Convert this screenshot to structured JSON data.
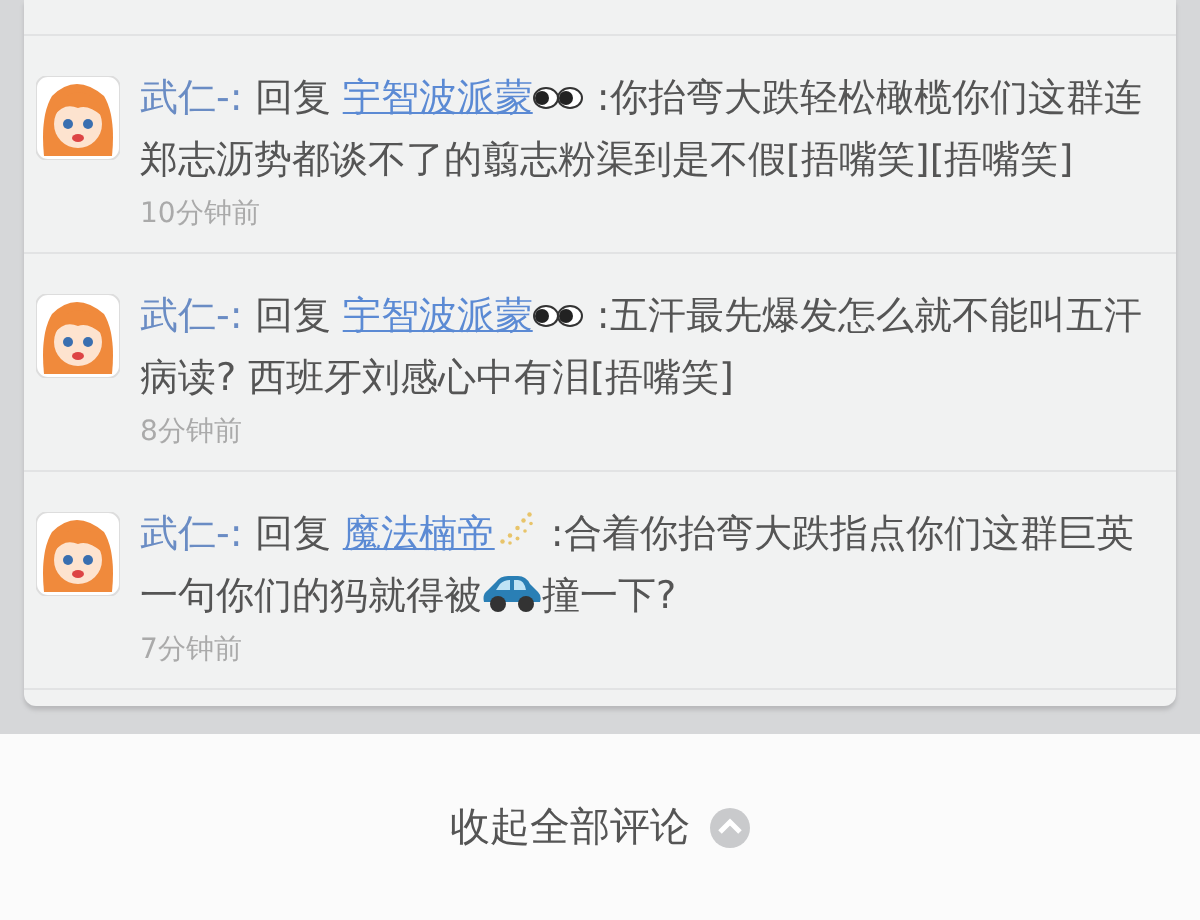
{
  "comments": [
    {
      "author": "武仁-:",
      "reply_word": "回复",
      "mention": "宇智波派蒙",
      "mention_emoji": {
        "kind": "eyes"
      },
      "segments": [
        {
          "kind": "text",
          "text": ":你抬弯大跌轻松橄榄你们这群连郑志沥势都谈不了的翦志粉渠到是不假[捂嘴笑][捂嘴笑]"
        }
      ],
      "time": "10分钟前"
    },
    {
      "author": "武仁-:",
      "reply_word": "回复",
      "mention": "宇智波派蒙",
      "mention_emoji": {
        "kind": "eyes"
      },
      "segments": [
        {
          "kind": "text",
          "text": ":五汗最先爆发怎么就不能叫五汗病读? 西班牙刘感心中有泪[捂嘴笑]"
        }
      ],
      "time": "8分钟前"
    },
    {
      "author": "武仁-:",
      "reply_word": "回复",
      "mention": "魔法楠帝",
      "mention_emoji": {
        "kind": "sparkle"
      },
      "segments": [
        {
          "kind": "text",
          "text": ":合着你抬弯大跌指点你们这群巨英一句你们的犸就得被"
        },
        {
          "kind": "car"
        },
        {
          "kind": "text",
          "text": "撞一下?"
        }
      ],
      "time": "7分钟前"
    }
  ],
  "footer": {
    "label": "收起全部评论"
  }
}
